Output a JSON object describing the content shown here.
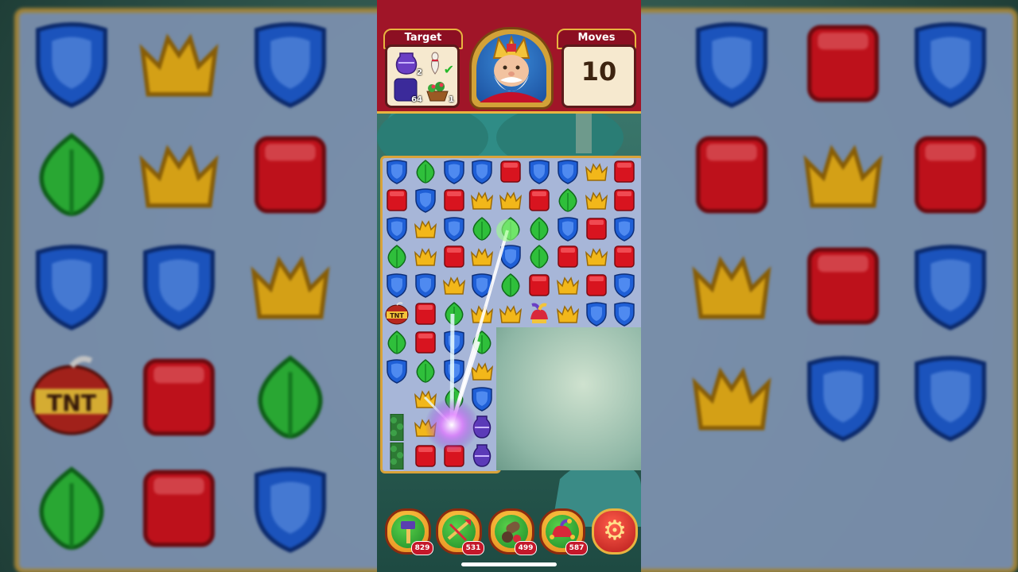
{
  "hud": {
    "target_label": "Target",
    "moves_label": "Moves",
    "moves_value": "10",
    "goals": [
      {
        "icon": "purple-vase-icon",
        "count": "2"
      },
      {
        "icon": "bowling-pin-icon",
        "count": "",
        "done": true
      },
      {
        "icon": "purple-cube-icon",
        "count": "64"
      },
      {
        "icon": "flower-basket-icon",
        "count": "1"
      }
    ],
    "character": "king-portrait"
  },
  "boosters": [
    {
      "icon": "hammer-icon",
      "count": "829"
    },
    {
      "icon": "arrow-icon",
      "count": "531"
    },
    {
      "icon": "cannon-icon",
      "count": "499"
    },
    {
      "icon": "jester-hat-icon",
      "count": "587"
    }
  ],
  "settings_icon": "gear-icon",
  "board": {
    "rows": [
      [
        "shield",
        "leaf",
        "shield",
        "shield",
        "cube",
        "shield",
        "shield",
        "crown",
        "cube"
      ],
      [
        "cube",
        "shield",
        "cube",
        "crown",
        "crown",
        "cube",
        "leaf",
        "crown",
        "cube"
      ],
      [
        "shield",
        "crown",
        "shield",
        "leaf",
        "leaf",
        "leaf",
        "shield",
        "cube",
        "shield"
      ],
      [
        "leaf",
        "crown",
        "cube",
        "crown",
        "shield",
        "leaf",
        "cube",
        "crown",
        "cube"
      ],
      [
        "shield",
        "shield",
        "crown",
        "shield",
        "leaf",
        "cube",
        "crown",
        "cube",
        "shield"
      ],
      [
        "tnt",
        "cube",
        "leaf",
        "crown",
        "crown",
        "jester",
        "crown",
        "shield",
        "shield"
      ],
      [
        "leaf",
        "cube",
        "shield",
        "leaf"
      ],
      [
        "shield",
        "leaf",
        "shield",
        "crown"
      ],
      [
        "empty",
        "crown",
        "leaf",
        "shield"
      ],
      [
        "tree",
        "crown",
        "",
        "vase"
      ],
      [
        "tree",
        "cube",
        "cube",
        "vase"
      ]
    ]
  },
  "colors": {
    "hud_red": "#a01528",
    "gold_border": "#d9a33a",
    "board_bg": "#a7b6d8",
    "shield": "#1f5fd6",
    "leaf": "#2fbf3b",
    "cube": "#d8141f",
    "crown": "#f2b71a"
  }
}
